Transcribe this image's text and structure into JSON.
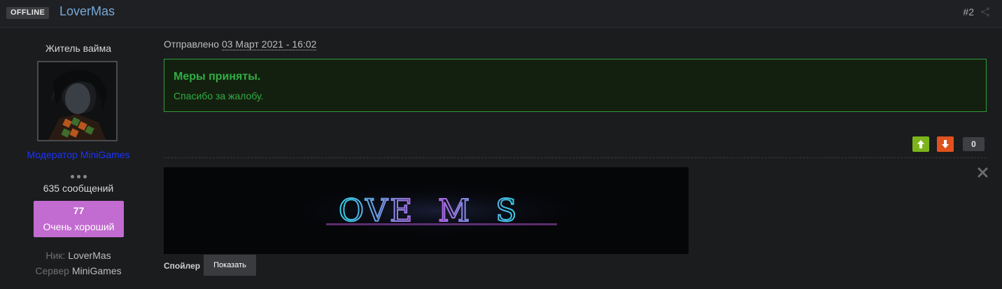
{
  "header": {
    "status_badge": "OFFLINE",
    "username": "LoverMas",
    "post_number": "#2",
    "share_icon": "share-icon"
  },
  "sidebar": {
    "rank_title": "Житель вайма",
    "avatar": "avatar-image",
    "group_name": "Модератор MiniGames",
    "group_color": "#1b34ff",
    "message_count": "635 сообщений",
    "reputation": {
      "value": "77",
      "label": "Очень хороший",
      "color": "#c26bd0"
    },
    "nick_label": "Ник:",
    "nick_value": "LoverMas",
    "server_label": "Сервер",
    "server_value": "MiniGames"
  },
  "post": {
    "posted_label": "Отправлено",
    "posted_date": "03 Март 2021 - 16:02",
    "notice": {
      "title": "Меры приняты.",
      "text": "Спасибо за жалобу.",
      "color": "#2fae45"
    },
    "votes": {
      "up_icon": "arrow-up-icon",
      "down_icon": "arrow-down-icon",
      "count": "0",
      "up_color": "#7cb51a",
      "down_color": "#e0521d"
    },
    "signature": {
      "banner_text": "OVE  M  S",
      "close_icon": "close-icon"
    },
    "spoiler": {
      "label": "Спойлер",
      "button": "Показать"
    }
  }
}
